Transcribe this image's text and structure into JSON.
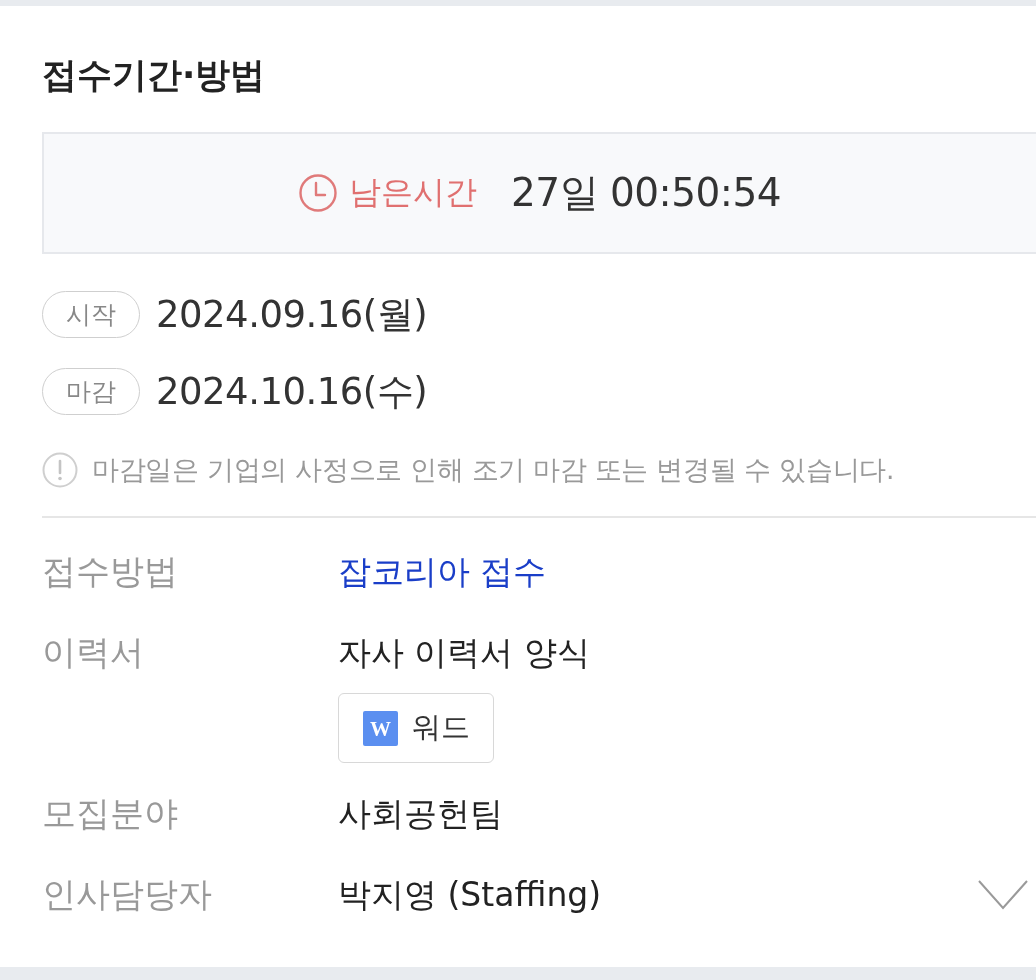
{
  "section": {
    "title": "접수기간·방법"
  },
  "remaining": {
    "label": "남은시간",
    "value": "27일 00:50:54"
  },
  "dates": [
    {
      "tag": "시작",
      "value": "2024.09.16(월)"
    },
    {
      "tag": "마감",
      "value": "2024.10.16(수)"
    }
  ],
  "notice": {
    "text": "마감일은 기업의 사정으로 인해 조기 마감 또는 변경될 수 있습니다."
  },
  "details": [
    {
      "label": "접수방법",
      "kind": "link",
      "value": "잡코리아 접수"
    },
    {
      "label": "이력서",
      "kind": "file",
      "value": "자사 이력서 양식",
      "file": {
        "icon_text": "W",
        "label": "워드"
      }
    },
    {
      "label": "모집분야",
      "kind": "text",
      "value": "사회공헌팀"
    },
    {
      "label": "인사담당자",
      "kind": "contact",
      "value": "박지영 (Staffing)"
    }
  ],
  "contact_toggle": {
    "expanded": false
  }
}
